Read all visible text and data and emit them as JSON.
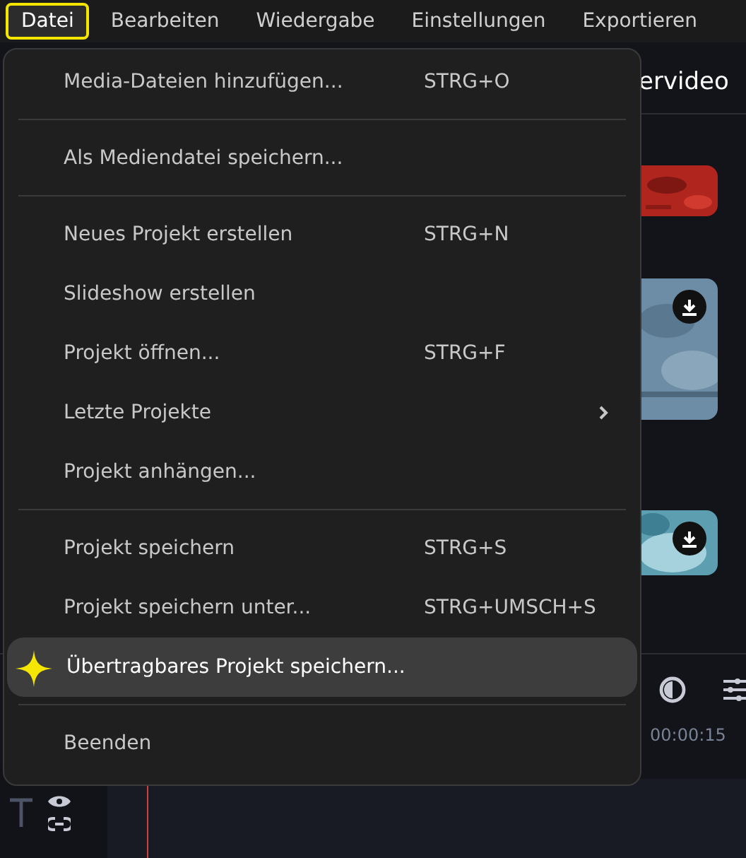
{
  "menubar": [
    {
      "label": "Datei",
      "selected": true
    },
    {
      "label": "Bearbeiten",
      "selected": false
    },
    {
      "label": "Wiedergabe",
      "selected": false
    },
    {
      "label": "Einstellungen",
      "selected": false
    },
    {
      "label": "Exportieren",
      "selected": false
    }
  ],
  "background": {
    "title": "ervideo",
    "timestamp": "00:00:15"
  },
  "menu": [
    {
      "kind": "item",
      "label": "Media-Dateien hinzufügen...",
      "shortcut": "STRG+O",
      "highlighted": false,
      "submenu": false
    },
    {
      "kind": "separator"
    },
    {
      "kind": "item",
      "label": "Als Mediendatei speichern...",
      "highlighted": false,
      "submenu": false
    },
    {
      "kind": "separator"
    },
    {
      "kind": "item",
      "label": "Neues Projekt erstellen",
      "shortcut": "STRG+N",
      "highlighted": false,
      "submenu": false
    },
    {
      "kind": "item",
      "label": "Slideshow erstellen",
      "highlighted": false,
      "submenu": false
    },
    {
      "kind": "item",
      "label": "Projekt öffnen...",
      "shortcut": "STRG+F",
      "highlighted": false,
      "submenu": false
    },
    {
      "kind": "item",
      "label": "Letzte Projekte",
      "highlighted": false,
      "submenu": true
    },
    {
      "kind": "item",
      "label": "Projekt anhängen...",
      "highlighted": false,
      "submenu": false
    },
    {
      "kind": "separator"
    },
    {
      "kind": "item",
      "label": "Projekt speichern",
      "shortcut": "STRG+S",
      "highlighted": false,
      "submenu": false
    },
    {
      "kind": "item",
      "label": "Projekt speichern unter...",
      "shortcut": "STRG+UMSCH+S",
      "highlighted": false,
      "submenu": false
    },
    {
      "kind": "item",
      "label": "Übertragbares Projekt speichern...",
      "highlighted": true,
      "submenu": false
    },
    {
      "kind": "separator"
    },
    {
      "kind": "item",
      "label": "Beenden",
      "highlighted": false,
      "submenu": false
    }
  ]
}
